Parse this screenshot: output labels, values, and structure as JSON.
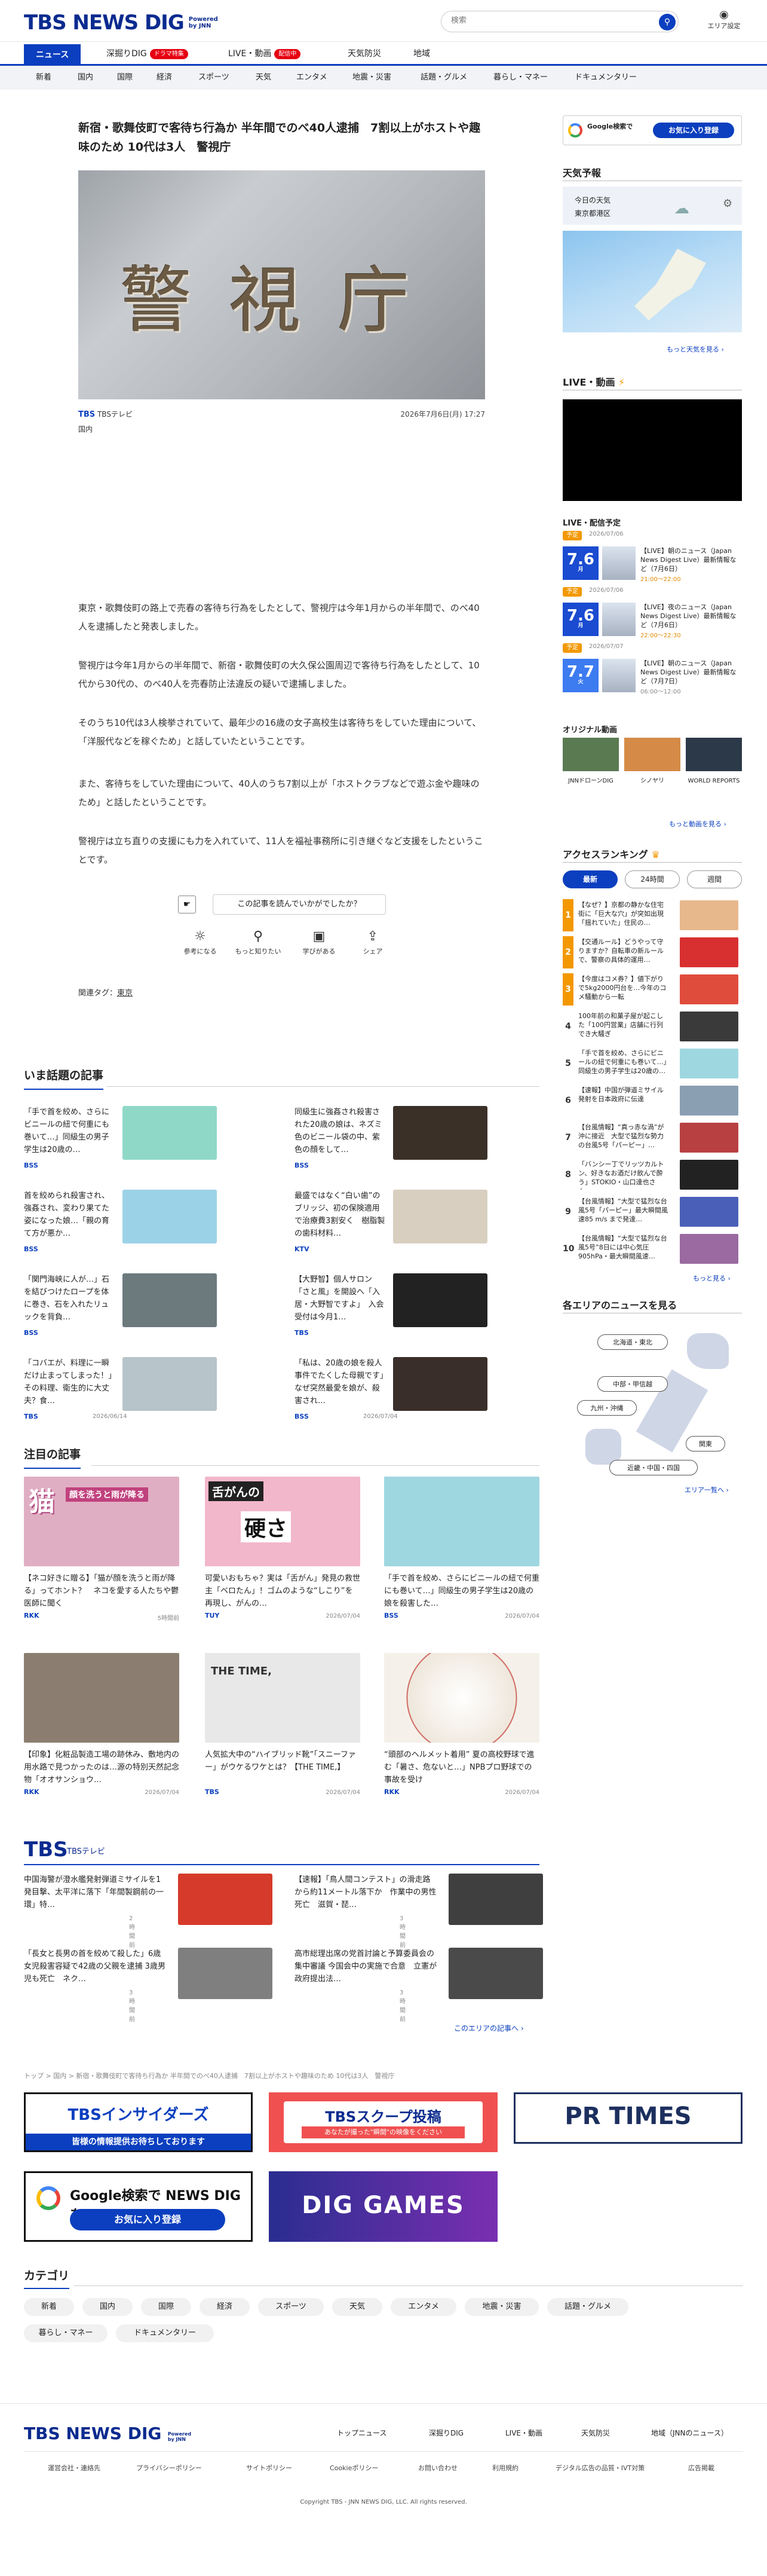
{
  "header": {
    "logo_text": "TBS NEWS DIG",
    "powered_by": "Powered",
    "powered_jnn": "by JNN",
    "search_placeholder": "検索",
    "area_setting": "エリア設定"
  },
  "main_nav": [
    {
      "label": "ニュース",
      "active": true
    },
    {
      "label": "深掘りDIG",
      "badge": "ドラマ特集",
      "badge_color": "#e60012"
    },
    {
      "label": "LIVE・動画",
      "badge": "配信中",
      "badge_color": "#e60012"
    },
    {
      "label": "天気防災"
    },
    {
      "label": "地域"
    }
  ],
  "category_nav": [
    "新着",
    "国内",
    "国際",
    "経済",
    "スポーツ",
    "天気",
    "エンタメ",
    "地震・災害",
    "話題・グルメ",
    "暮らし・マネー",
    "ドキュメンタリー"
  ],
  "article": {
    "headline": "新宿・歌舞伎町で客待ち行為か 半年間でのべ40人逮捕　7割以上がホストや趣味のため 10代は3人　警視庁",
    "hero_text": "警 視 庁",
    "source": "TBSテレビ",
    "date": "2026年7月6日(月) 17:27",
    "category": "国内",
    "paragraphs": [
      "東京・歌舞伎町の路上で売春の客待ち行為をしたとして、警視庁は今年1月からの半年間で、のべ40人を逮捕したと発表しました。",
      "警視庁は今年1月からの半年間で、新宿・歌舞伎町の大久保公園周辺で客待ち行為をしたとして、10代から30代の、のべ40人を売春防止法違反の疑いで逮捕しました。",
      "そのうち10代は3人検挙されていて、最年少の16歳の女子高校生は客待ちをしていた理由について、「洋服代などを稼ぐため」と話していたということです。",
      "また、客待ちをしていた理由について、40人のうち7割以上が「ホストクラブなどで遊ぶ金や趣味のため」と話したということです。",
      "警視庁は立ち直りの支援にも力を入れていて、11人を福祉事務所に引き継ぐなど支援をしたということです。"
    ],
    "reader_question": "この記事を読んでいかがでしたか？",
    "reactions": [
      {
        "label": "参考になる",
        "icon": "lightbulb-icon"
      },
      {
        "label": "もっと知りたい",
        "icon": "magnifier-icon"
      },
      {
        "label": "学びがある",
        "icon": "book-icon"
      },
      {
        "label": "シェア",
        "icon": "share-icon"
      }
    ],
    "tags_label": "関連タグ：",
    "tag": "東京"
  },
  "trending": {
    "title": "いま話題の記事",
    "items": [
      {
        "title": "「手で首を絞め、さらにビニールの紐で何重にも巻いて…」同級生の男子学生は20歳の…",
        "src": "BSS",
        "date": "",
        "color": "#8fd8c8"
      },
      {
        "title": "同級生に強姦され殺害された20歳の娘は、ネズミ色のビニール袋の中、紫色の顔をして…",
        "src": "BSS",
        "date": "",
        "color": "#3b3028"
      },
      {
        "title": "首を絞められ殺害され、強姦され、変わり果てた姿になった娘…「親の育て方が悪か…",
        "src": "BSS",
        "date": "",
        "color": "#9cd2e8"
      },
      {
        "title": "最盛ではなく“白い歯”のブリッジ、初の保険適用で治療費3割安く　樹脂製の歯科材料…",
        "src": "KTV",
        "date": "",
        "color": "#d8cfc0"
      },
      {
        "title": "「関門海峡に人が…」石を結びつけたロープを体に巻き、石を入れたリュックを背負…",
        "src": "BSS",
        "date": "",
        "color": "#6c7a7e"
      },
      {
        "title": "【大野智】個人サロン「さと風」を開設へ「入居・大野智ですよ」　入会受付は今月1…",
        "src": "TBS",
        "date": "",
        "color": "#222"
      },
      {
        "title": "「コバエが、料理に一瞬だけ止まってしまった！」その料理、衛生的に大丈夫？食…",
        "src": "TBS",
        "date": "2026/06/14",
        "color": "#b7c4c9"
      },
      {
        "title": "「私は、20歳の娘を殺人事件でたくした母親です」なぜ突然最愛を娘が、殺害され…",
        "src": "BSS",
        "date": "2026/07/04",
        "color": "#3a2e2a"
      }
    ]
  },
  "featured": {
    "title": "注目の記事",
    "items": [
      {
        "title": "【ネコ好きに贈る】「猫が顔を洗うと雨が降る」ってホント？　ネコを愛する人たちや鬱医師に聞く",
        "src": "RKK",
        "date": "5時間前",
        "overlay": "猫",
        "overlay2": "顔を洗うと雨が降る",
        "color": "#e0aec2"
      },
      {
        "title": "可愛いおもちゃ？実は「舌がん」発見の救世主「ベロたん」！ゴムのような“しこり”を再現し、がんの…",
        "src": "TUY",
        "date": "2026/07/04",
        "overlay": "舌がんの",
        "overlay2": "硬さ",
        "color": "#f3b7cc"
      },
      {
        "title": "「手で首を絞め、さらにビニールの紐で何重にも巻いて…」同級生の男子学生は20歳の娘を殺害した…",
        "src": "BSS",
        "date": "2026/07/04",
        "overlay": "",
        "overlay2": "",
        "color": "#9fd7e0"
      },
      {
        "title": "【印象】化粧品製造工場の跡休み、敷地内の用水路で見つかったのは…源の特別天然記念物「オオサンショウ…",
        "src": "RKK",
        "date": "2026/07/04",
        "overlay": "",
        "overlay2": "",
        "color": "#8b7e70"
      },
      {
        "title": "人気拡大中の“ハイブリッド靴”「スニーファー」がウケるワケとは？【THE TIME,】",
        "src": "TBS",
        "date": "2026/07/04",
        "overlay": "THE TIME,",
        "overlay2": "",
        "color": "#e8e8e8"
      },
      {
        "title": "“頭部のヘルメット着用” 夏の高校野球で進む「暑さ、危ないと…」NPBプロ野球での事故を受け",
        "src": "RKK",
        "date": "2026/07/04",
        "overlay": "",
        "overlay2": "",
        "color": "#f5f1ea"
      }
    ]
  },
  "tbs_block": {
    "logo": "TBS",
    "sub": "TBSテレビ",
    "items": [
      {
        "title": "中国海警が澄水艦発射弾道ミサイルを1発目撃、太平洋に落下「年間製鋼前の一環」特…",
        "date": "2時間前",
        "color": "#d63a2a"
      },
      {
        "title": "【速報】「鳥人間コンテスト」の滑走路から約11メートル落下か　作業中の男性死亡　滋賀・琵…",
        "date": "3時間前",
        "color": "#3f3f3f"
      },
      {
        "title": "「長女と長男の首を絞めて殺した」6歳女児殺害容疑で42歳の父親を逮捕 3歳男児も死亡　ネク…",
        "date": "3時間前",
        "color": "#7f7f7f"
      },
      {
        "title": "高市総理出席の党首討論と予算委員会の集中審議 今国会中の実施で合意　立憲が政府提出法…",
        "date": "3時間前",
        "color": "#4a4a4a"
      }
    ],
    "more": "このエリアの記事へ"
  },
  "breadcrumb": "トップ > 国内 > 新宿・歌舞伎町で客待ち行為か 半年間でのべ40人逮捕　7割以上がホストや趣味のため 10代は3人　警視庁",
  "banners": [
    {
      "name": "tbs-insiders",
      "line1": "TBSインサイダーズ",
      "line2": "皆様の情報提供お待ちしております"
    },
    {
      "name": "tbs-scoop",
      "line1": "TBSスクープ投稿",
      "line2": "あなたが撮った\"瞬間\"の映像をください"
    },
    {
      "name": "pr-times",
      "line1": "PR TIMES",
      "line2": ""
    },
    {
      "name": "google-search",
      "line1": "Google検索で NEWS DIG を",
      "line2": "お気に入り登録"
    },
    {
      "name": "dig-games",
      "line1": "DIG GAMES",
      "line2": ""
    }
  ],
  "categories": {
    "title": "カテゴリ",
    "items": [
      "新着",
      "国内",
      "国際",
      "経済",
      "スポーツ",
      "天気",
      "エンタメ",
      "地震・災害",
      "話題・グルメ",
      "暮らし・マネー",
      "ドキュメンタリー"
    ]
  },
  "footer": {
    "logo": "TBS NEWS DIG",
    "links": [
      "トップニュース",
      "深掘りDIG",
      "LIVE・動画",
      "天気防災",
      "地域（JNNのニュース）"
    ],
    "sub_links": [
      "運営会社・連絡先",
      "プライバシーポリシー",
      "サイトポリシー",
      "Cookieポリシー",
      "お問い合わせ",
      "利用規約",
      "デジタル広告の品質・IVT対策",
      "広告掲載"
    ],
    "copyright": "Copyright TBS - JNN NEWS DIG, LLC. All rights reserved."
  },
  "sidebar": {
    "google_banner": {
      "line1": "Google検索で",
      "line2": "お気に入り登録"
    },
    "weather": {
      "title": "天気予報",
      "today": "今日の天気",
      "location": "東京都港区",
      "more": "もっと天気を見る"
    },
    "live": {
      "title": "LIVE・動画",
      "schedule_title": "LIVE・配信予定",
      "items": [
        {
          "label": "予定",
          "date_small": "2026/07/06",
          "day": "7.6",
          "dow": "月",
          "title": "【LIVE】朝のニュース（Japan News Digest Live）最新情報など（7月6日）",
          "time": "21:00～22:00",
          "label_color": "#f39800",
          "day_color": "#1a4bd0"
        },
        {
          "label": "予定",
          "date_small": "2026/07/06",
          "day": "7.6",
          "dow": "月",
          "title": "【LIVE】夜のニュース（Japan News Digest Live）最新情報など（7月6日）",
          "time": "22:00～22:30",
          "label_color": "#f39800",
          "day_color": "#1a4bd0"
        },
        {
          "label": "予定",
          "date_small": "2026/07/07",
          "day": "7.7",
          "dow": "火",
          "title": "【LIVE】朝のニュース（Japan News Digest Live）最新情報など（7月7日）",
          "time": "06:00～12:00",
          "label_color": "#f39800",
          "day_color": "#3c7bf0"
        }
      ],
      "original_title": "オリジナル動画",
      "originals": [
        {
          "label": "JNNドローンDIG",
          "color": "#5a7a52"
        },
        {
          "label": "シノヤリ",
          "color": "#d58a47"
        },
        {
          "label": "WORLD REPORTS",
          "color": "#2b3948"
        }
      ],
      "more": "もっと動画を見る"
    },
    "ranking": {
      "title": "アクセスランキング",
      "tabs": [
        "最新",
        "24時間",
        "週間"
      ],
      "items": [
        {
          "n": "1",
          "title": "【なぜ？】京都の静かな住宅街に「巨大な穴」が突如出現「揺れていた」住民の…",
          "color": "#e8b88d"
        },
        {
          "n": "2",
          "title": "【交通ルール】どうやって守りますか？自転車の新ルールで、警察の具体的運用…",
          "color": "#d83030"
        },
        {
          "n": "3",
          "title": "【今度はコメ券？】値下がりで5kg2000円台を…今年のコメ騒動から一転",
          "color": "#e04c3c"
        },
        {
          "n": "4",
          "title": "100年前の和菓子屋が起こした「100円営業」店舗に行列でき大騒ぎ",
          "color": "#3a3a3a"
        },
        {
          "n": "5",
          "title": "「手で首を絞め、さらにビニールの紐で何重にも巻いて…」同級生の男子学生は20歳の…",
          "color": "#9fd7e0"
        },
        {
          "n": "6",
          "title": "【速報】中国が弾道ミサイル発射を日本政府に伝達",
          "color": "#8aa0b2"
        },
        {
          "n": "7",
          "title": "【台風情報】“真っ赤な渦”が沖に接近　大型で猛烈な勢力の台風5号「パーピー」…",
          "color": "#b84040"
        },
        {
          "n": "8",
          "title": "「バンシー丁でリッツカルトン、好きなお酒だけ飲んで酔う」STOKIO・山口達也さん…",
          "color": "#222"
        },
        {
          "n": "9",
          "title": "【台風情報】“大型で猛烈な台風5号「パーピー」最大瞬間風速85 m/s まで発達…",
          "color": "#4a5fb8"
        },
        {
          "n": "10",
          "title": "【台風情報】“大型で猛烈な台風5号”8日には中心気圧905hPa・最大瞬間風速…",
          "color": "#9a6aa0"
        }
      ],
      "more": "もっと見る"
    },
    "regions": {
      "title": "各エリアのニュースを見る",
      "buttons": [
        "北海道・東北",
        "中部・甲信越",
        "九州・沖縄",
        "関東",
        "近畿・中国・四国"
      ],
      "more": "エリア一覧へ"
    }
  }
}
